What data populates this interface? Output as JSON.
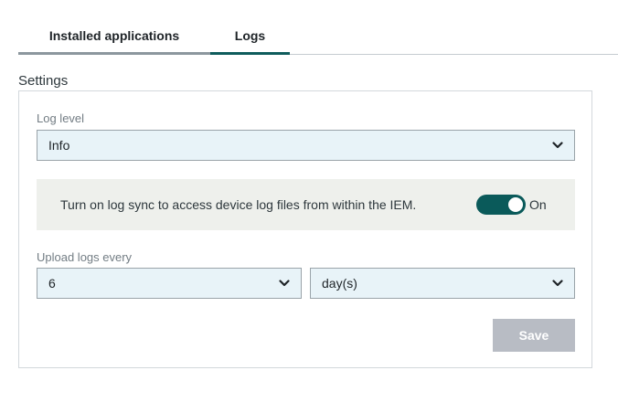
{
  "tabs": [
    {
      "label": "Installed applications",
      "active": false
    },
    {
      "label": "Logs",
      "active": true
    }
  ],
  "settings": {
    "title": "Settings",
    "log_level": {
      "label": "Log level",
      "value": "Info"
    },
    "log_sync": {
      "text": "Turn on log sync to access device log files from within the IEM.",
      "enabled": true,
      "state_label": "On"
    },
    "upload": {
      "label": "Upload logs every",
      "amount": "6",
      "unit": "day(s)"
    },
    "save_label": "Save"
  },
  "icons": {
    "dropdown": "chevron-down-icon"
  },
  "colors": {
    "accent": "#0a5a5a",
    "input_bg": "#e8f3f8",
    "sync_bg": "#eef0ec",
    "save_disabled": "#b8bcc4"
  }
}
